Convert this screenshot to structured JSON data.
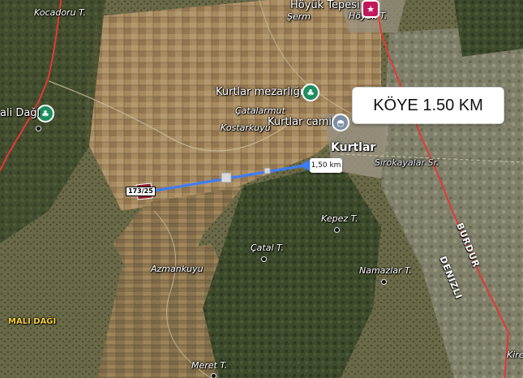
{
  "map": {
    "callout_text": "KÖYE 1.50 KM",
    "distance_label": "1,50 km",
    "parcel_label": "173/25",
    "labels": {
      "kocadoru": "Kocadoru T.",
      "hoyuk_tepesi": "Höyük Tepesi",
      "serm": "Şerm",
      "hoyuk_t": "Höyük T.",
      "mali_dagi_top": "ali Dağı",
      "kurtlar_mezarligi": "Kurtlar mezarlığı",
      "catalarmut": "Çatalarmut",
      "kostarkuyu": "Kostarkuyu",
      "kurtlar_cami": "Kurtlar cami",
      "kurtlar": "Kurtlar",
      "sirokayalar": "Sırokayalar Sr.",
      "kepez": "Kepez T.",
      "catal": "Çatal T.",
      "azmankuyu": "Azmankuyu",
      "namazlar": "Namazlar T.",
      "mali_dagi_bottom": "MALI DAĞI",
      "meret": "Meret T.",
      "burdur": "BURDUR",
      "denizli": "DENIZLI",
      "kire": "Kire"
    },
    "icons": {
      "park": "tree-icon",
      "cemetery": "tree-icon",
      "mosque": "mosque-icon",
      "place": "pink-pin-icon"
    },
    "colors": {
      "route_line": "#3b7dff",
      "boundary": "#e53935",
      "callout_bg": "#ffffff"
    }
  }
}
